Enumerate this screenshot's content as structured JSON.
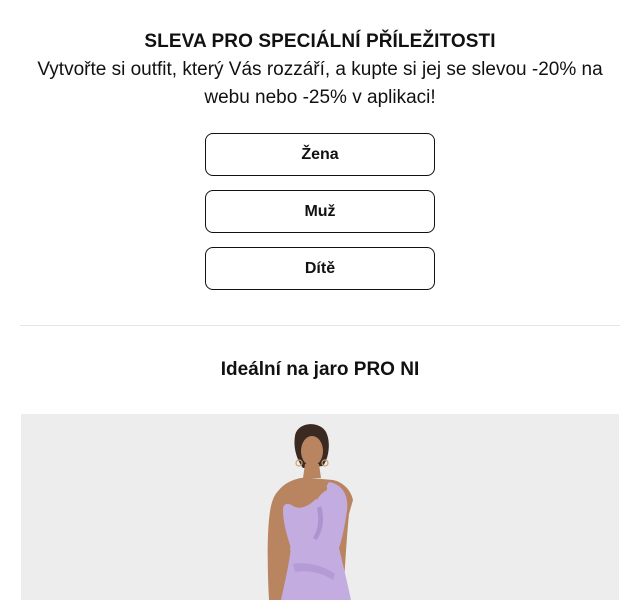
{
  "promo": {
    "title": "SLEVA PRO SPECIÁLNÍ PŘÍLEŽITOSTI",
    "text": "Vytvořte si outfit, který Vás rozzáří, a kupte si jej se slevou -20% na webu nebo -25% v aplikaci!",
    "buttons": [
      {
        "label": "Žena"
      },
      {
        "label": "Muž"
      },
      {
        "label": "Dítě"
      }
    ]
  },
  "section": {
    "title": "Ideální na jaro PRO NI"
  },
  "product": {
    "image_icon": "model-in-lilac-one-shoulder-dress",
    "colors": {
      "background": "#ededed",
      "dress": "#c3ace0",
      "skin": "#b98561"
    }
  }
}
